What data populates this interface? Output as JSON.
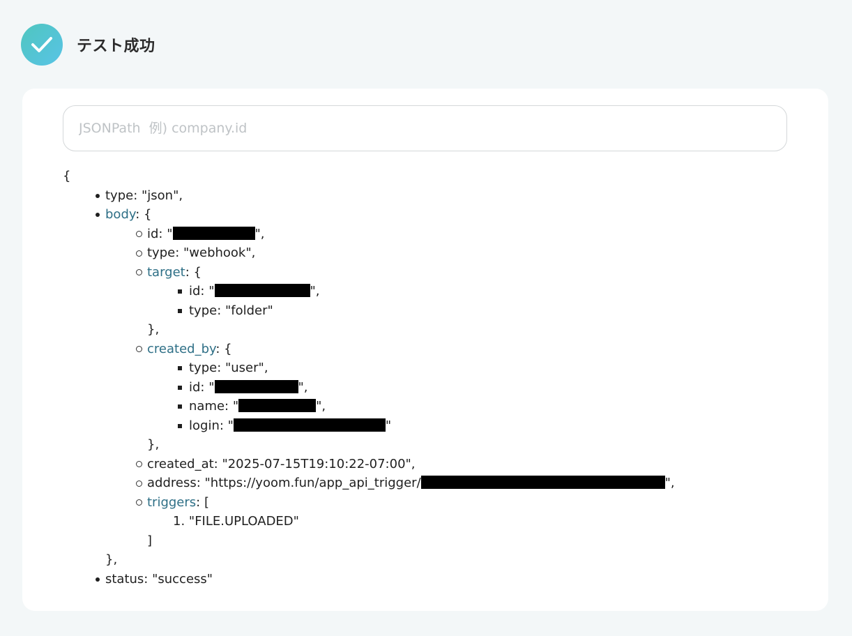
{
  "header": {
    "title": "テスト成功",
    "icon": "check-icon"
  },
  "search": {
    "placeholder": "JSONPath  例) company.id",
    "value": ""
  },
  "json": {
    "open_brace": "{",
    "type_line": "type: \"json\",",
    "body_key": "body",
    "body_open": ": {",
    "body_id_prefix": "id: \"",
    "body_id_suffix": "\",",
    "body_type": "type: \"webhook\",",
    "target_key": "target",
    "target_open": ": {",
    "target_id_prefix": "id: \"",
    "target_id_suffix": "\",",
    "target_type": "type: \"folder\"",
    "target_close": "},",
    "created_by_key": "created_by",
    "created_by_open": ": {",
    "cb_type": "type: \"user\",",
    "cb_id_prefix": "id: \"",
    "cb_id_suffix": "\",",
    "cb_name_prefix": "name: \"",
    "cb_name_suffix": "\",",
    "cb_login_prefix": "login: \"",
    "cb_login_suffix": "\"",
    "created_by_close": "},",
    "created_at": "created_at: \"2025-07-15T19:10:22-07:00\",",
    "address_prefix": "address: \"https://yoom.fun/app_api_trigger/",
    "address_suffix": "\",",
    "triggers_key": "triggers",
    "triggers_open": ": [",
    "trigger_number": "1.",
    "trigger_item": "\"FILE.UPLOADED\"",
    "triggers_close": "]",
    "body_close": "},",
    "status": "status: \"success\""
  },
  "colors": {
    "link_key": "#2e6f86",
    "badge_start": "#4fc6bf",
    "badge_end": "#58c3e6"
  }
}
